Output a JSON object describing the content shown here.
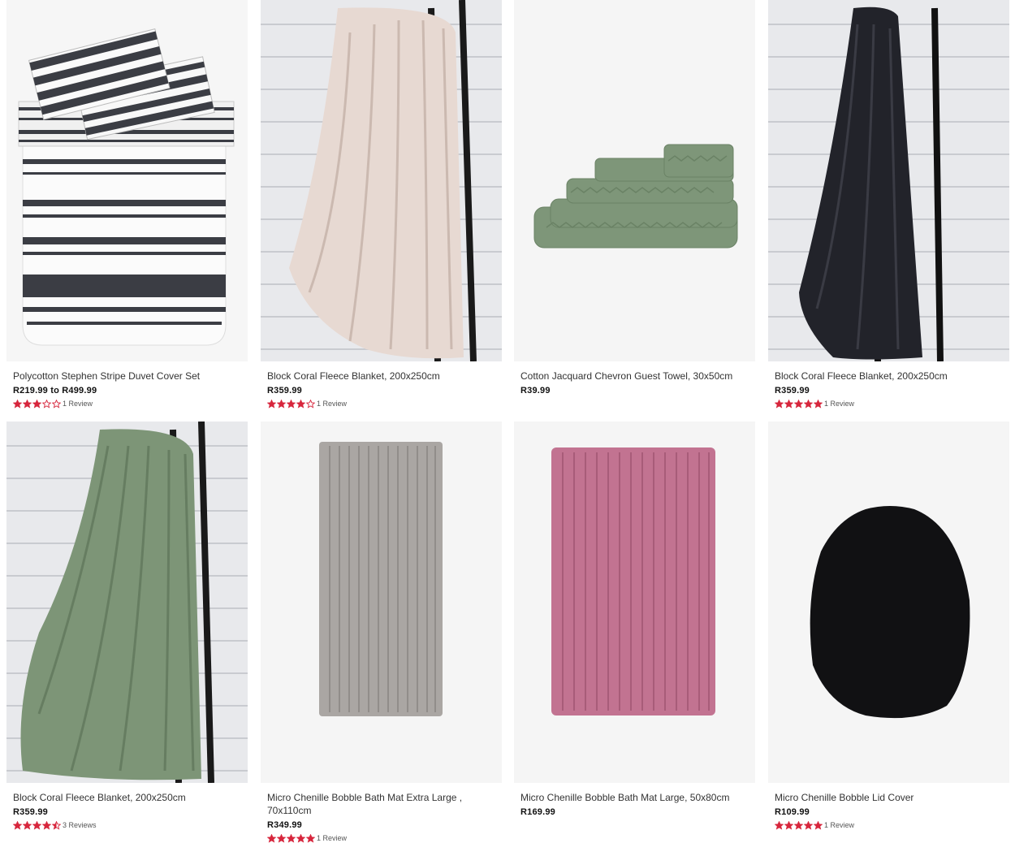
{
  "products": [
    {
      "title": "Polycotton Stephen Stripe Duvet Cover Set",
      "price": "R219.99 to R499.99",
      "rating": 3,
      "reviews": "1 Review",
      "image": "striped-duvet"
    },
    {
      "title": "Block Coral Fleece Blanket, 200x250cm",
      "price": "R359.99",
      "rating": 4,
      "reviews": "1 Review",
      "image": "cream-blanket-ladder"
    },
    {
      "title": "Cotton Jacquard Chevron Guest Towel, 30x50cm",
      "price": "R39.99",
      "rating": null,
      "reviews": "",
      "image": "green-towel-stack"
    },
    {
      "title": "Block Coral Fleece Blanket, 200x250cm",
      "price": "R359.99",
      "rating": 5,
      "reviews": "1 Review",
      "image": "black-blanket-ladder"
    },
    {
      "title": "Block Coral Fleece Blanket, 200x250cm",
      "price": "R359.99",
      "rating": 4.5,
      "reviews": "3 Reviews",
      "image": "green-blanket-ladder"
    },
    {
      "title": "Micro Chenille Bobble Bath Mat Extra Large , 70x110cm",
      "price": "R349.99",
      "rating": 5,
      "reviews": "1 Review",
      "image": "grey-bath-mat"
    },
    {
      "title": "Micro Chenille Bobble Bath Mat Large, 50x80cm",
      "price": "R169.99",
      "rating": null,
      "reviews": "",
      "image": "pink-bath-mat"
    },
    {
      "title": "Micro Chenille Bobble Lid Cover",
      "price": "R109.99",
      "rating": 5,
      "reviews": "1 Review",
      "image": "black-lid-cover"
    }
  ],
  "colors": {
    "star": "#d7263d",
    "price": "#111111",
    "title": "#333333"
  }
}
